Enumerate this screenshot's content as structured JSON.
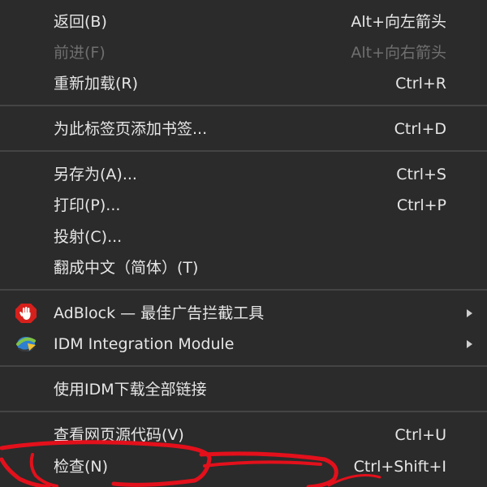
{
  "menu": {
    "back": {
      "label": "返回(B)",
      "shortcut": "Alt+向左箭头"
    },
    "forward": {
      "label": "前进(F)",
      "shortcut": "Alt+向右箭头"
    },
    "reload": {
      "label": "重新加载(R)",
      "shortcut": "Ctrl+R"
    },
    "bookmark": {
      "label": "为此标签页添加书签...",
      "shortcut": "Ctrl+D"
    },
    "save_as": {
      "label": "另存为(A)...",
      "shortcut": "Ctrl+S"
    },
    "print": {
      "label": "打印(P)...",
      "shortcut": "Ctrl+P"
    },
    "cast": {
      "label": "投射(C)..."
    },
    "translate": {
      "label": "翻成中文（简体）(T)"
    },
    "adblock": {
      "label": "AdBlock — 最佳广告拦截工具",
      "icon": "adblock-hand-icon"
    },
    "idm_module": {
      "label": "IDM Integration Module",
      "icon": "idm-icon"
    },
    "idm_download_all": {
      "label": "使用IDM下载全部链接"
    },
    "view_source": {
      "label": "查看网页源代码(V)",
      "shortcut": "Ctrl+U"
    },
    "inspect": {
      "label": "检查(N)",
      "shortcut": "Ctrl+Shift+I"
    }
  },
  "colors": {
    "background": "#2b2b2b",
    "text": "#e6e6e6",
    "disabled_text": "#6f6f6f",
    "separator": "#444444",
    "annotation": "#e3101b",
    "adblock_red": "#d6201c"
  }
}
